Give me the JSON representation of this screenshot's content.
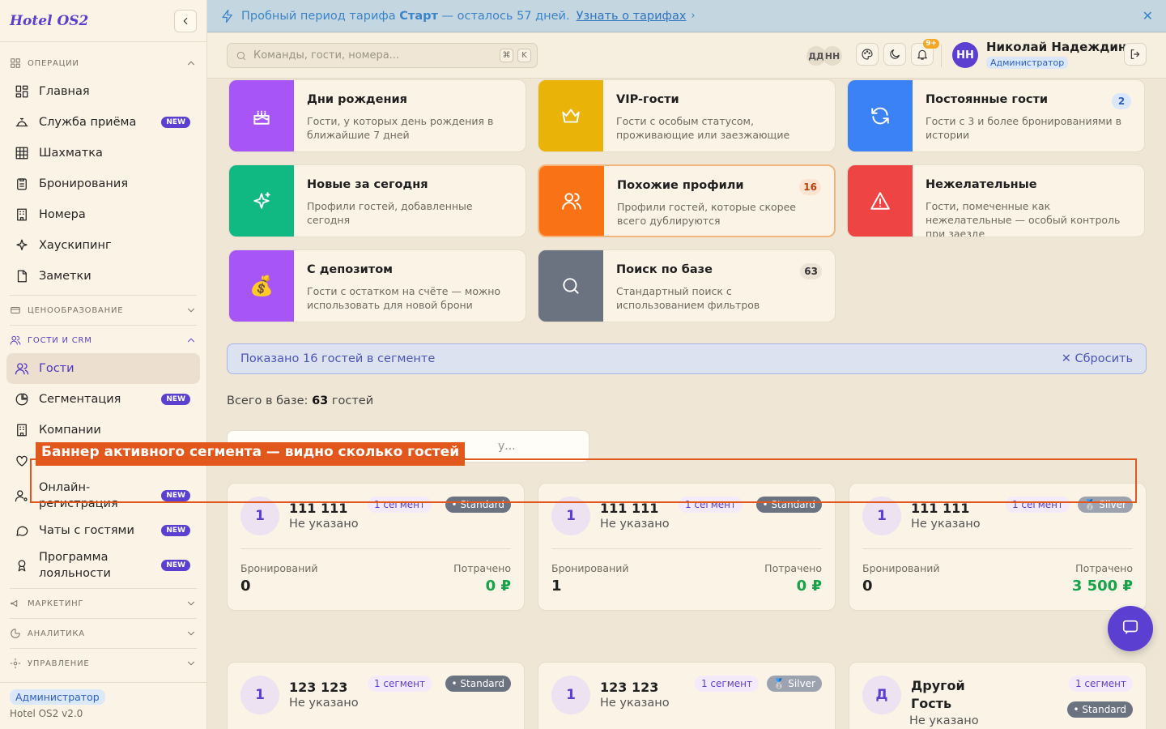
{
  "sidebar": {
    "brand": "Hotel OS2",
    "groups": {
      "operations": "ОПЕРАЦИИ",
      "pricing": "ЦЕНООБРАЗОВАНИЕ",
      "crm": "ГОСТИ И CRM",
      "marketing": "МАРКЕТИНГ",
      "analytics": "АНАЛИТИКА",
      "management": "УПРАВЛЕНИЕ"
    },
    "items": {
      "home": "Главная",
      "frontdesk": "Служба приёма",
      "chess": "Шахматка",
      "bookings": "Бронирования",
      "rooms": "Номера",
      "housekeeping": "Хаускипинг",
      "notes": "Заметки",
      "guests": "Гости",
      "segmentation": "Сегментация",
      "companies": "Компании",
      "online1": "Онлайн-",
      "online2": "регистрация",
      "chats": "Чаты с гостями",
      "loyalty1": "Программа",
      "loyalty2": "лояльности"
    },
    "new_badge": "NEW",
    "footer_role": "Администратор",
    "footer_version": "Hotel OS2 v2.0"
  },
  "trial": {
    "prefix": "Пробный период тарифа ",
    "plan": "Старт",
    "suffix": " — осталось 57 дней.",
    "link": "Узнать о тарифах"
  },
  "header": {
    "search_placeholder": "Команды, гости, номера...",
    "kbd1": "⌘",
    "kbd2": "K",
    "presence1": "ДД",
    "presence2": "НН",
    "notif_count": "9+",
    "user_initials": "НН",
    "user_name": "Николай Надеждин",
    "user_role": "Администратор"
  },
  "segments": [
    {
      "title": "Дни рождения",
      "desc": "Гости, у которых день рождения в ближайшие 7 дней",
      "count": "",
      "color": "#a855f7",
      "icon": "cake-icon"
    },
    {
      "title": "VIP-гости",
      "desc": "Гости с особым статусом, проживающие или заезжающие",
      "count": "",
      "color": "#eab308",
      "icon": "crown-icon"
    },
    {
      "title": "Постоянные гости",
      "desc": "Гости с 3 и более бронированиями в истории",
      "count": "2",
      "color": "#3b82f6",
      "icon": "refresh-icon"
    },
    {
      "title": "Новые за сегодня",
      "desc": "Профили гостей, добавленные сегодня",
      "count": "",
      "color": "#10b981",
      "icon": "sparkles-icon"
    },
    {
      "title": "Похожие профили",
      "desc": "Профили гостей, которые скорее всего дублируются",
      "count": "16",
      "color": "#f97316",
      "icon": "users-icon"
    },
    {
      "title": "Нежелательные",
      "desc": "Гости, помеченные как нежелательные — особый контроль при заезде",
      "count": "",
      "color": "#ef4444",
      "icon": "warning-icon"
    },
    {
      "title": "С депозитом",
      "desc": "Гости с остатком на счёте — можно использовать для новой брони",
      "count": "",
      "color": "#a855f7",
      "icon": "money-bag-icon"
    },
    {
      "title": "Поиск по базе",
      "desc": "Стандартный поиск с использованием фильтров",
      "count": "63",
      "color": "#6b7280",
      "icon": "search-icon"
    }
  ],
  "active_segment": {
    "text": "Показано 16 гостей в сегменте",
    "reset": "Сбросить"
  },
  "total": {
    "prefix": "Всего в базе: ",
    "count": "63",
    "suffix": " гостей"
  },
  "guest_search_placeholder": "у...",
  "guests": [
    {
      "initial": "1",
      "name": "111 111",
      "status": "Не указано",
      "segments": "1 сегмент",
      "tier": "Standard",
      "bookings_label": "Бронирований",
      "bookings": "0",
      "spent_label": "Потрачено",
      "spent": "0 ₽"
    },
    {
      "initial": "1",
      "name": "111 111",
      "status": "Не указано",
      "segments": "1 сегмент",
      "tier": "Standard",
      "bookings_label": "Бронирований",
      "bookings": "1",
      "spent_label": "Потрачено",
      "spent": "0 ₽"
    },
    {
      "initial": "1",
      "name": "111 111",
      "status": "Не указано",
      "segments": "1 сегмент",
      "tier": "Silver",
      "bookings_label": "Бронирований",
      "bookings": "0",
      "spent_label": "Потрачено",
      "spent": "3 500 ₽"
    },
    {
      "initial": "1",
      "name": "123 123",
      "status": "Не указано",
      "segments": "1 сегмент",
      "tier": "Standard"
    },
    {
      "initial": "1",
      "name": "123 123",
      "status": "Не указано",
      "segments": "1 сегмент",
      "tier": "Silver"
    },
    {
      "initial": "Д",
      "name1": "Другой",
      "name2": "Гость",
      "status": "Не указано",
      "segments": "1 сегмент",
      "tier": "Standard"
    }
  ],
  "annotation": "Баннер активного сегмента — видно сколько гостей"
}
